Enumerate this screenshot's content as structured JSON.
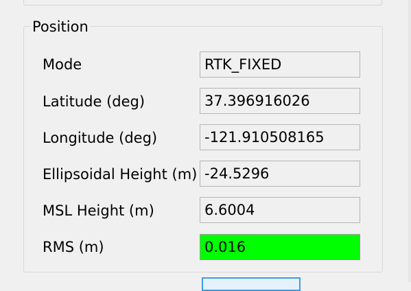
{
  "position_group": {
    "title": "Position",
    "rows": [
      {
        "label": "Mode",
        "value": "RTK_FIXED",
        "status": "normal"
      },
      {
        "label": "Latitude (deg)",
        "value": "37.396916026",
        "status": "normal"
      },
      {
        "label": "Longitude (deg)",
        "value": "-121.910508165",
        "status": "normal"
      },
      {
        "label": "Ellipsoidal Height (m)",
        "value": "-24.5296",
        "status": "normal"
      },
      {
        "label": "MSL Height (m)",
        "value": "6.6004",
        "status": "normal"
      },
      {
        "label": "RMS (m)",
        "value": "0.016",
        "status": "good"
      }
    ]
  },
  "colors": {
    "window_bg": "#f0f0f0",
    "field_border": "#b4b4b4",
    "good_status": "#00ff00",
    "button_focus_border": "#3c9de0"
  }
}
